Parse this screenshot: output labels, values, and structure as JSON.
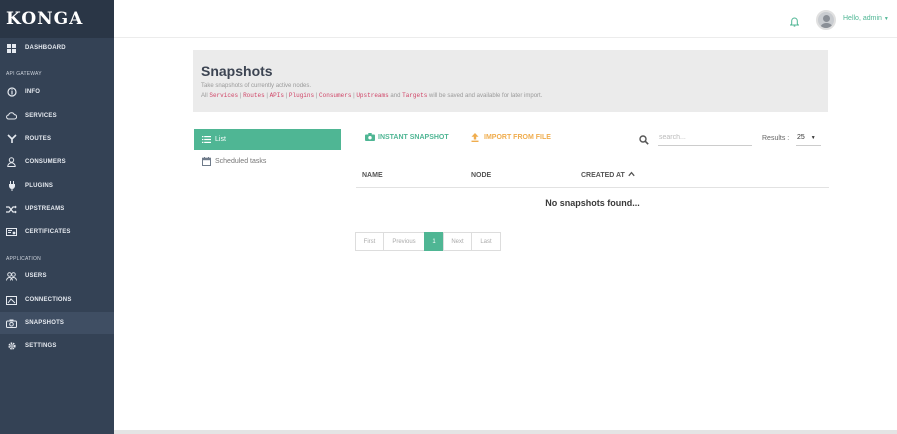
{
  "brand": "KONGA",
  "sidebar": {
    "items": [
      {
        "label": "DASHBOARD",
        "icon": "dashboard-icon"
      },
      {
        "label": "INFO",
        "icon": "info-icon"
      },
      {
        "label": "SERVICES",
        "icon": "cloud-icon"
      },
      {
        "label": "ROUTES",
        "icon": "routes-icon"
      },
      {
        "label": "CONSUMERS",
        "icon": "user-icon"
      },
      {
        "label": "PLUGINS",
        "icon": "plug-icon"
      },
      {
        "label": "UPSTREAMS",
        "icon": "shuffle-icon"
      },
      {
        "label": "CERTIFICATES",
        "icon": "certificate-icon"
      },
      {
        "label": "USERS",
        "icon": "users-icon"
      },
      {
        "label": "CONNECTIONS",
        "icon": "connections-icon"
      },
      {
        "label": "SNAPSHOTS",
        "icon": "camera-icon"
      },
      {
        "label": "SETTINGS",
        "icon": "gear-icon"
      }
    ],
    "sections": {
      "api_gateway": "API GATEWAY",
      "application": "APPLICATION"
    }
  },
  "topbar": {
    "greeting": "Hello, admin",
    "bell_icon": "bell-icon",
    "avatar_icon": "avatar-icon"
  },
  "header": {
    "title": "Snapshots",
    "subtitle": "Take snapshots of currently active nodes.",
    "desc_prefix": "All",
    "tags": [
      "Services",
      "Routes",
      "APIs",
      "Plugins",
      "Consumers",
      "Upstreams",
      "Targets"
    ],
    "desc_and": "and",
    "desc_suffix": "will be saved and available for later import."
  },
  "tabs": {
    "list": "List",
    "scheduled": "Scheduled tasks"
  },
  "actions": {
    "instant_snapshot": "INSTANT SNAPSHOT",
    "import_from_file": "IMPORT FROM FILE"
  },
  "search": {
    "placeholder": "search..."
  },
  "results": {
    "label": "Results :",
    "value": "25"
  },
  "table": {
    "columns": [
      "NAME",
      "NODE",
      "CREATED AT"
    ],
    "sort_indicator": "^",
    "empty_message": "No snapshots found..."
  },
  "pagination": {
    "items": [
      "First",
      "Previous",
      "1",
      "Next",
      "Last"
    ],
    "active": "1"
  },
  "colors": {
    "sidebar": "#344255",
    "accent": "#4fb694",
    "import": "#f0ad4e",
    "tag": "#d04567"
  }
}
